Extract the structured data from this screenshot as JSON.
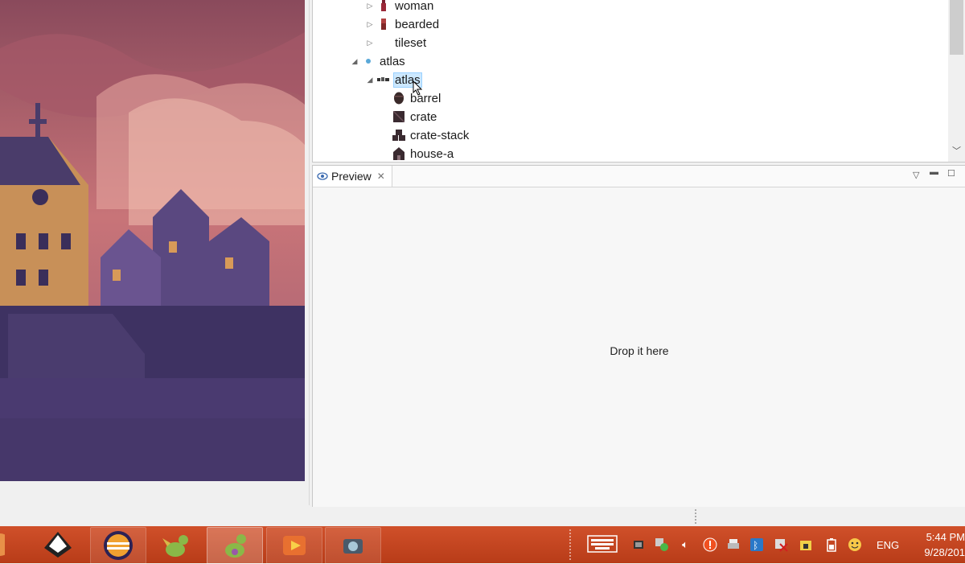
{
  "outline": {
    "items": [
      {
        "label": "woman",
        "icon": "woman-sprite-icon",
        "expanded": false
      },
      {
        "label": "bearded",
        "icon": "bearded-sprite-icon",
        "expanded": false
      },
      {
        "label": "tileset",
        "icon": "",
        "expanded": false
      },
      {
        "label": "atlas",
        "icon": "atlas-folder-icon",
        "expanded": true
      },
      {
        "label": "atlas",
        "icon": "atlas-image-icon",
        "expanded": true,
        "selected": true
      },
      {
        "label": "barrel",
        "icon": "barrel-icon"
      },
      {
        "label": "crate",
        "icon": "crate-icon"
      },
      {
        "label": "crate-stack",
        "icon": "crate-stack-icon"
      },
      {
        "label": "house-a",
        "icon": "house-icon"
      }
    ]
  },
  "preview": {
    "tab_label": "Preview",
    "drop_hint": "Drop it here"
  },
  "taskbar": {
    "language": "ENG",
    "time": "5:44 PM",
    "date": "9/28/201"
  },
  "colors": {
    "taskbar": "#c44521",
    "selection": "#cce8ff",
    "sky": "#b05a6a",
    "buildings": "#4a3a70"
  }
}
